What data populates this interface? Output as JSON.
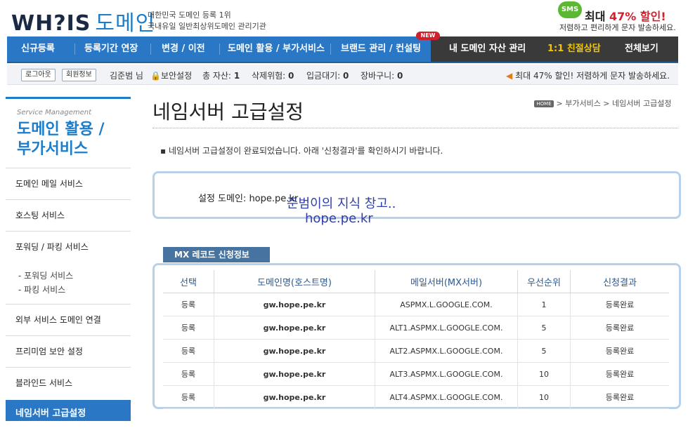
{
  "header": {
    "logo_text": "WH?IS",
    "logo_kr": "도메인",
    "tagline_1": "대한민국 도메인 등록 1위",
    "tagline_2": "국내유일 일반최상위도메인 관리기관",
    "sms_bubble": "SMS",
    "sms_title_pre": "최대 ",
    "sms_title_pct": "47% 할인!",
    "sms_sub": "저렴하고 편리하게 문자 발송하세요."
  },
  "nav": {
    "items": [
      "신규등록",
      "등록기간 연장",
      "변경 / 이전",
      "도메인 활용 / 부가서비스",
      "브랜드 관리 / 컨설팅"
    ],
    "new_badge": "NEW",
    "dark_items": [
      "내 도메인 자산 관리",
      "1:1 친절상담",
      "전체보기"
    ]
  },
  "subbar": {
    "logout": "로그아웃",
    "member_info": "회원정보",
    "user": "김준범 님",
    "security": "보안설정",
    "total_assets_label": "총 자산:",
    "total_assets": "1",
    "delete_risk_label": "삭제위험:",
    "delete_risk": "0",
    "pending_label": "입금대기:",
    "pending": "0",
    "cart_label": "장바구니:",
    "cart": "0",
    "promo": "최대 47% 할인! 저렴하게 문자 발송하세요."
  },
  "sidebar": {
    "small": "Service Management",
    "title_1": "도메인 활용 /",
    "title_2": "부가서비스",
    "items": [
      "도메인 메일 서비스",
      "호스팅 서비스",
      "포워딩 / 파킹 서비스"
    ],
    "sub_items": [
      "- 포워딩 서비스",
      "- 파킹 서비스"
    ],
    "items2": [
      "외부 서비스 도메인 연결",
      "프리미엄 보안 설정",
      "블라인드 서비스"
    ],
    "active": "네임서버 고급설정"
  },
  "main": {
    "title": "네임서버 고급설정",
    "crumb_home": "HOME",
    "crumb_rest": " > 부가서비스 > 네임서버 고급설정",
    "notice": "▪  네임서버 고급설정이 완료되었습니다. 아래 '신청결과'를 확인하시기 바랍니다.",
    "domain_line": "설정 도메인: hope.pe.kr",
    "overlay_1": "준범이의 지식 창고..",
    "overlay_2": "hope.pe.kr",
    "mx_tab": "MX 레코드 신청정보"
  },
  "mx_table": {
    "headers": [
      "선택",
      "도메인명(호스트명)",
      "메일서버(MX서버)",
      "우선순위",
      "신청결과"
    ],
    "rows": [
      [
        "등록",
        "gw.hope.pe.kr",
        "ASPMX.L.GOOGLE.COM.",
        "1",
        "등록완료"
      ],
      [
        "등록",
        "gw.hope.pe.kr",
        "ALT1.ASPMX.L.GOOGLE.COM.",
        "5",
        "등록완료"
      ],
      [
        "등록",
        "gw.hope.pe.kr",
        "ALT2.ASPMX.L.GOOGLE.COM.",
        "5",
        "등록완료"
      ],
      [
        "등록",
        "gw.hope.pe.kr",
        "ALT3.ASPMX.L.GOOGLE.COM.",
        "10",
        "등록완료"
      ],
      [
        "등록",
        "gw.hope.pe.kr",
        "ALT4.ASPMX.L.GOOGLE.COM.",
        "10",
        "등록완료"
      ]
    ]
  }
}
